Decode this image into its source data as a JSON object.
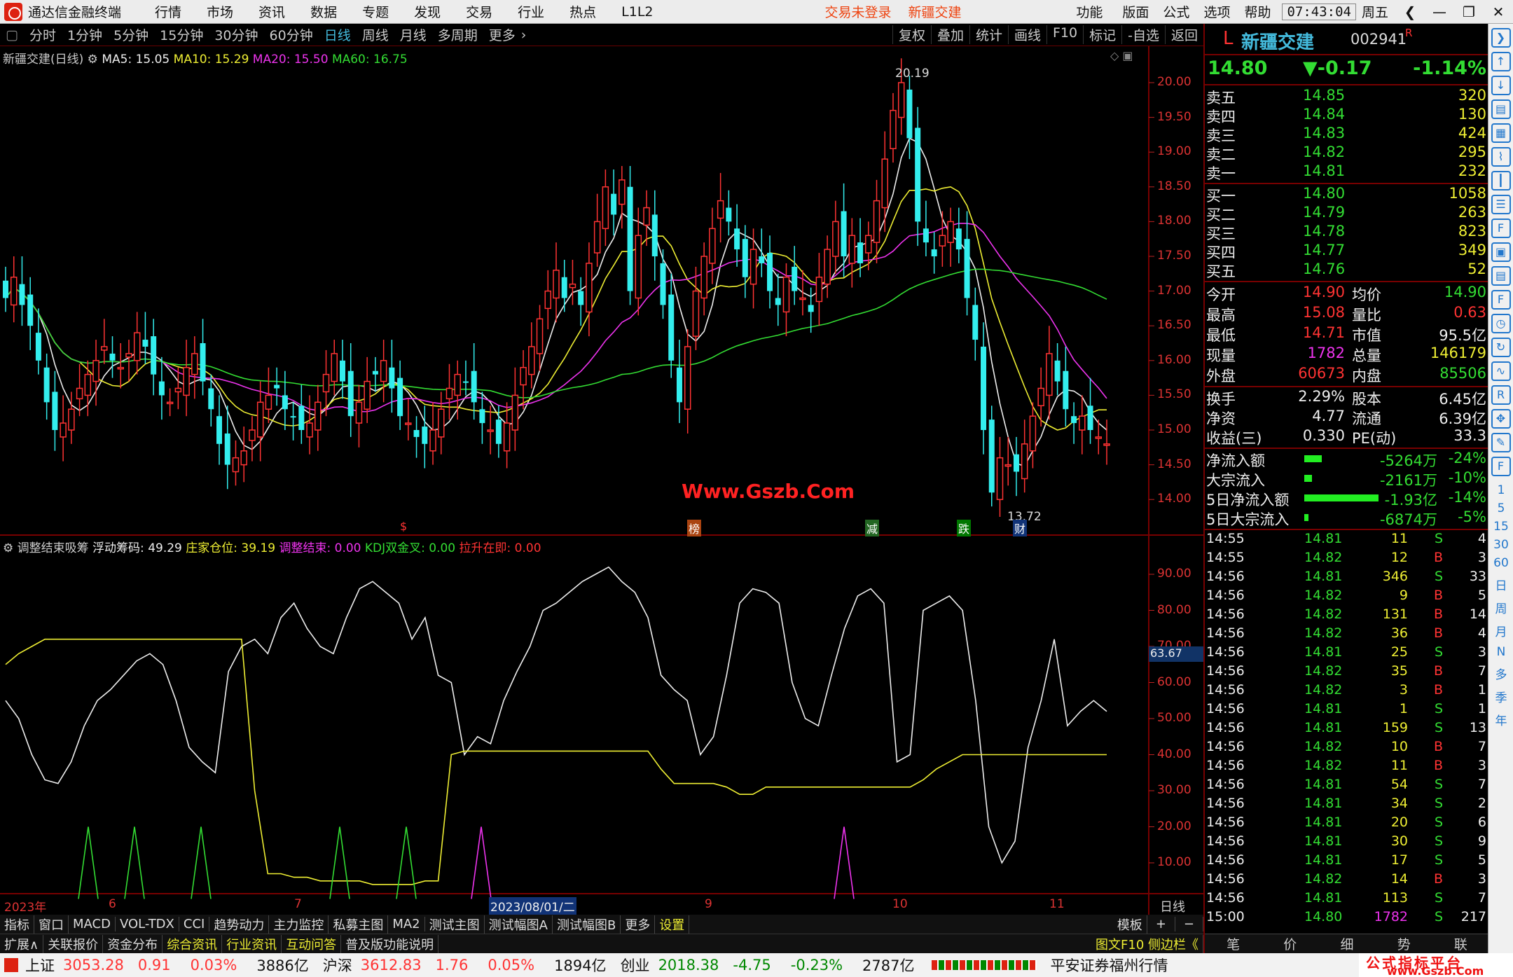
{
  "app": {
    "title": "通达信金融终端",
    "menu": [
      "行情",
      "市场",
      "资讯",
      "数据",
      "专题",
      "发现",
      "交易",
      "行业",
      "热点",
      "L1L2"
    ],
    "trade_status": "交易未登录",
    "stock_title": "新疆交建",
    "right_menu": [
      "功能",
      "版面",
      "公式",
      "选项",
      "帮助"
    ],
    "time": "07:43:04",
    "weekday": "周五"
  },
  "periods": {
    "items": [
      "分时",
      "1分钟",
      "5分钟",
      "15分钟",
      "30分钟",
      "60分钟",
      "日线",
      "周线",
      "月线",
      "多周期",
      "更多"
    ],
    "active": "日线",
    "right": [
      "复权",
      "叠加",
      "统计",
      "画线",
      "F10",
      "标记",
      "-自选",
      "返回"
    ]
  },
  "main_chart": {
    "name": "新疆交建(日线)",
    "ma5_label": "MA5: 15.05",
    "ma10_label": "MA10: 15.29",
    "ma20_label": "MA20: 15.50",
    "ma60_label": "MA60: 16.75",
    "y_ticks": [
      "20.00",
      "19.50",
      "19.00",
      "18.50",
      "18.00",
      "17.50",
      "17.00",
      "16.50",
      "16.00",
      "15.50",
      "15.00",
      "14.50",
      "14.00"
    ],
    "high_label": "20.19",
    "low_label": "13.72",
    "watermark": "Www.Gszb.Com",
    "markers": [
      "$",
      "榜",
      "减",
      "跌",
      "财"
    ]
  },
  "indicator": {
    "name": "调整结束吸筹",
    "float_label": "浮动筹码: 49.29",
    "zhuangjia_label": "庄家仓位: 39.19",
    "tiaozheng_label": "调整结束: 0.00",
    "kdj_label": "KDJ双金叉: 0.00",
    "lasheng_label": "拉升在即: 0.00",
    "y_ticks": [
      "90.00",
      "80.00",
      "70.00",
      "60.00",
      "50.00",
      "40.00",
      "30.00",
      "20.00",
      "10.00"
    ],
    "current_tag": "63.67"
  },
  "x_axis": {
    "labels": [
      "2023年",
      "6",
      "7",
      "2023/08/01/二",
      "9",
      "10",
      "11"
    ],
    "period": "日线"
  },
  "quote": {
    "prefix": "L",
    "name": "新疆交建",
    "code": "002941",
    "r": "R",
    "price": "14.80",
    "change": "▼-0.17",
    "pct": "-1.14%",
    "asks": [
      {
        "l": "卖五",
        "p": "14.85",
        "v": "320"
      },
      {
        "l": "卖四",
        "p": "14.84",
        "v": "130"
      },
      {
        "l": "卖三",
        "p": "14.83",
        "v": "424"
      },
      {
        "l": "卖二",
        "p": "14.82",
        "v": "295"
      },
      {
        "l": "卖一",
        "p": "14.81",
        "v": "232"
      }
    ],
    "bids": [
      {
        "l": "买一",
        "p": "14.80",
        "v": "1058"
      },
      {
        "l": "买二",
        "p": "14.79",
        "v": "263"
      },
      {
        "l": "买三",
        "p": "14.78",
        "v": "823"
      },
      {
        "l": "买四",
        "p": "14.77",
        "v": "349"
      },
      {
        "l": "买五",
        "p": "14.76",
        "v": "52"
      }
    ],
    "stats": [
      [
        "今开",
        "14.90",
        "均价",
        "14.90"
      ],
      [
        "最高",
        "15.08",
        "量比",
        "0.63"
      ],
      [
        "最低",
        "14.71",
        "市值",
        "95.5亿"
      ],
      [
        "现量",
        "1782",
        "总量",
        "146179"
      ],
      [
        "外盘",
        "60673",
        "内盘",
        "85506"
      ]
    ],
    "stats2": [
      [
        "换手",
        "2.29%",
        "股本",
        "6.45亿"
      ],
      [
        "净资",
        "4.77",
        "流通",
        "6.39亿"
      ],
      [
        "收益(三)",
        "0.330",
        "PE(动)",
        "33.3"
      ]
    ],
    "flows": [
      {
        "l": "净流入额",
        "v": "-5264万",
        "p": "-24%",
        "bar": 0.24
      },
      {
        "l": "大宗流入",
        "v": "-2161万",
        "p": "-10%",
        "bar": 0.1
      },
      {
        "l": "5日净流入额",
        "v": "-1.93亿",
        "p": "-14%",
        "bar": 1.0
      },
      {
        "l": "5日大宗流入",
        "v": "-6874万",
        "p": "-5%",
        "bar": 0.05
      }
    ],
    "ticks": [
      [
        "14:55",
        "14.81",
        "11",
        "S",
        "4"
      ],
      [
        "14:55",
        "14.82",
        "12",
        "B",
        "3"
      ],
      [
        "14:56",
        "14.81",
        "346",
        "S",
        "33"
      ],
      [
        "14:56",
        "14.82",
        "9",
        "B",
        "5"
      ],
      [
        "14:56",
        "14.82",
        "131",
        "B",
        "14"
      ],
      [
        "14:56",
        "14.82",
        "36",
        "B",
        "4"
      ],
      [
        "14:56",
        "14.81",
        "25",
        "S",
        "3"
      ],
      [
        "14:56",
        "14.82",
        "35",
        "B",
        "7"
      ],
      [
        "14:56",
        "14.82",
        "3",
        "B",
        "1"
      ],
      [
        "14:56",
        "14.81",
        "1",
        "S",
        "1"
      ],
      [
        "14:56",
        "14.81",
        "159",
        "S",
        "13"
      ],
      [
        "14:56",
        "14.82",
        "10",
        "B",
        "7"
      ],
      [
        "14:56",
        "14.82",
        "11",
        "B",
        "3"
      ],
      [
        "14:56",
        "14.81",
        "54",
        "S",
        "7"
      ],
      [
        "14:56",
        "14.81",
        "34",
        "S",
        "2"
      ],
      [
        "14:56",
        "14.81",
        "20",
        "S",
        "6"
      ],
      [
        "14:56",
        "14.81",
        "30",
        "S",
        "9"
      ],
      [
        "14:56",
        "14.81",
        "17",
        "S",
        "5"
      ],
      [
        "14:56",
        "14.82",
        "14",
        "B",
        "3"
      ],
      [
        "14:56",
        "14.81",
        "113",
        "S",
        "7"
      ],
      [
        "15:00",
        "14.80",
        "1782",
        "S",
        "217"
      ]
    ],
    "bottom_tabs": [
      "笔",
      "价",
      "细",
      "势",
      "联"
    ]
  },
  "tabs1": [
    "指标",
    "窗口",
    "MACD",
    "VOL-TDX",
    "CCI",
    "趋势动力",
    "主力监控",
    "私募主图",
    "MA2",
    "测试主图",
    "测试幅图A",
    "测试幅图B",
    "更多",
    "设置"
  ],
  "tabs1_right": [
    "模板",
    "+",
    "−"
  ],
  "tabs2": [
    "扩展∧",
    "关联报价",
    "资金分布",
    "综合资讯",
    "行业资讯",
    "互动问答",
    "普及版功能说明"
  ],
  "tabs2_right": "图文F10 侧边栏《",
  "status": {
    "sh_name": "上证",
    "sh_val": "3053.28",
    "sh_chg": "0.91",
    "sh_pct": "0.03%",
    "sh_amt": "3886亿",
    "hs_name": "沪深",
    "hs_val": "3612.83",
    "hs_chg": "1.76",
    "hs_pct": "0.05%",
    "hs_amt": "1894亿",
    "cy_name": "创业",
    "cy_val": "2018.38",
    "cy_chg": "-4.75",
    "cy_pct": "-0.23%",
    "cy_amt": "2787亿",
    "broker": "平安证券福州行情",
    "logo_line1": "公式指标平台",
    "logo_line2": "www.Gszb.Com"
  },
  "sidebar_labels": [
    "日",
    "周",
    "月",
    "N",
    "多",
    "季",
    "年"
  ]
}
